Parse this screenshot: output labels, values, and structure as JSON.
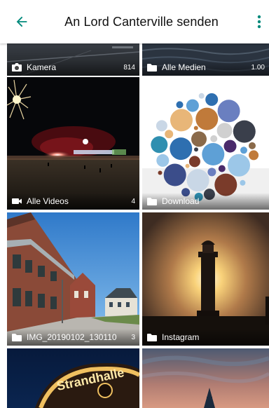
{
  "appbar": {
    "title": "An Lord Canterville senden",
    "back_icon": "arrow-left-icon",
    "menu_icon": "more-vertical-icon",
    "accent": "#00897B"
  },
  "albums": [
    {
      "name": "Kamera",
      "count": "814",
      "icon": "camera-icon"
    },
    {
      "name": "Alle Medien",
      "count": "1.00",
      "icon": "folder-icon"
    },
    {
      "name": "Alle Videos",
      "count": "4",
      "icon": "video-icon"
    },
    {
      "name": "Download",
      "count": "",
      "icon": "folder-icon"
    },
    {
      "name": "IMG_20190102_130110",
      "count": "3",
      "icon": "folder-icon"
    },
    {
      "name": "Instagram",
      "count": "",
      "icon": "folder-icon"
    },
    {
      "name": "",
      "count": "",
      "icon": ""
    },
    {
      "name": "",
      "count": "",
      "icon": ""
    }
  ],
  "thumbnail_text": {
    "strandhalle_sign": "Strandhalle"
  }
}
